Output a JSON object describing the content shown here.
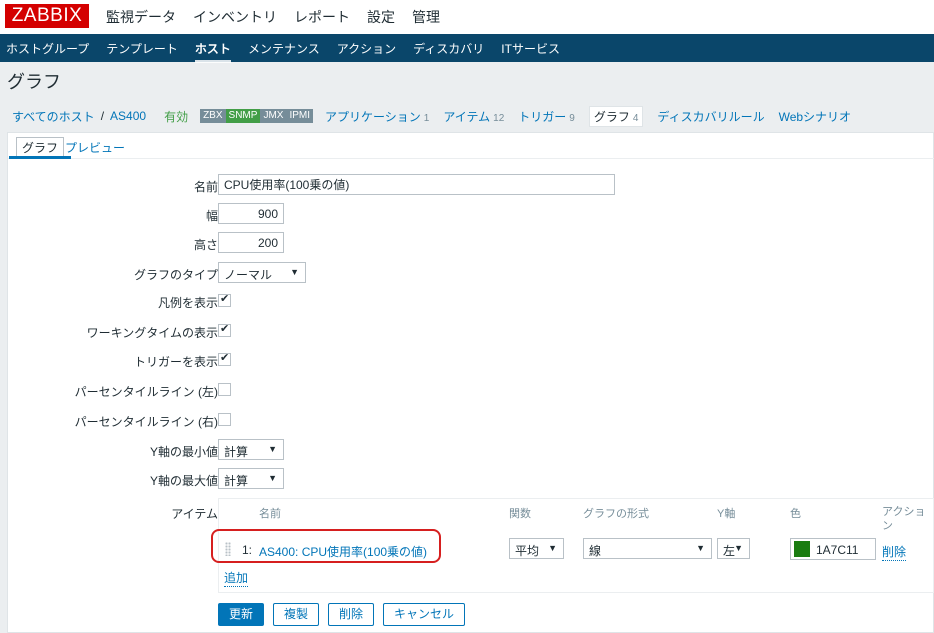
{
  "logo": "ZABBIX",
  "top_menu": [
    "監視データ",
    "インベントリ",
    "レポート",
    "設定",
    "管理"
  ],
  "sub_menu": [
    "ホストグループ",
    "テンプレート",
    "ホスト",
    "メンテナンス",
    "アクション",
    "ディスカバリ",
    "ITサービス"
  ],
  "sub_menu_active": "ホスト",
  "page_title": "グラフ",
  "breadcrumb": {
    "all_hosts": "すべてのホスト",
    "separator": "/",
    "host": "AS400",
    "status": "有効",
    "badges": [
      "ZBX",
      "SNMP",
      "JMX",
      "IPMI"
    ],
    "tabs": [
      {
        "label": "アプリケーション",
        "count": "1"
      },
      {
        "label": "アイテム",
        "count": "12"
      },
      {
        "label": "トリガー",
        "count": "9"
      },
      {
        "label": "グラフ",
        "count": "4"
      },
      {
        "label": "ディスカバリルール",
        "count": ""
      },
      {
        "label": "Webシナリオ",
        "count": ""
      }
    ]
  },
  "form_tabs": [
    "グラフ",
    "プレビュー"
  ],
  "form": {
    "name_label": "名前",
    "name_value": "CPU使用率(100乗の値)",
    "width_label": "幅",
    "width_value": "900",
    "height_label": "高さ",
    "height_value": "200",
    "graph_type_label": "グラフのタイプ",
    "graph_type_value": "ノーマル",
    "show_legend_label": "凡例を表示",
    "show_legend": true,
    "show_working_time_label": "ワーキングタイムの表示",
    "show_working_time": true,
    "show_triggers_label": "トリガーを表示",
    "show_triggers": true,
    "percentile_left_label": "パーセンタイルライン (左)",
    "percentile_left": false,
    "percentile_right_label": "パーセンタイルライン (右)",
    "percentile_right": false,
    "ymin_label": "Y軸の最小値",
    "ymin_value": "計算",
    "ymax_label": "Y軸の最大値",
    "ymax_value": "計算",
    "items_label": "アイテム"
  },
  "items_table": {
    "headers": {
      "name": "名前",
      "function": "関数",
      "draw_style": "グラフの形式",
      "y_axis": "Y軸",
      "color": "色",
      "action": "アクション"
    },
    "rows": [
      {
        "num": "1:",
        "name": "AS400: CPU使用率(100乗の値)",
        "function": "平均",
        "draw_style": "線",
        "y_axis": "左",
        "color": "1A7C11",
        "action": "削除"
      }
    ],
    "add_link": "追加"
  },
  "buttons": {
    "update": "更新",
    "clone": "複製",
    "delete": "削除",
    "cancel": "キャンセル"
  },
  "colors": {
    "brand": "#d40000",
    "nav": "#0a466a",
    "link": "#0275b8",
    "enabled": "#429e47",
    "item_color": "#1A7C11",
    "highlight": "#d61f1f"
  }
}
